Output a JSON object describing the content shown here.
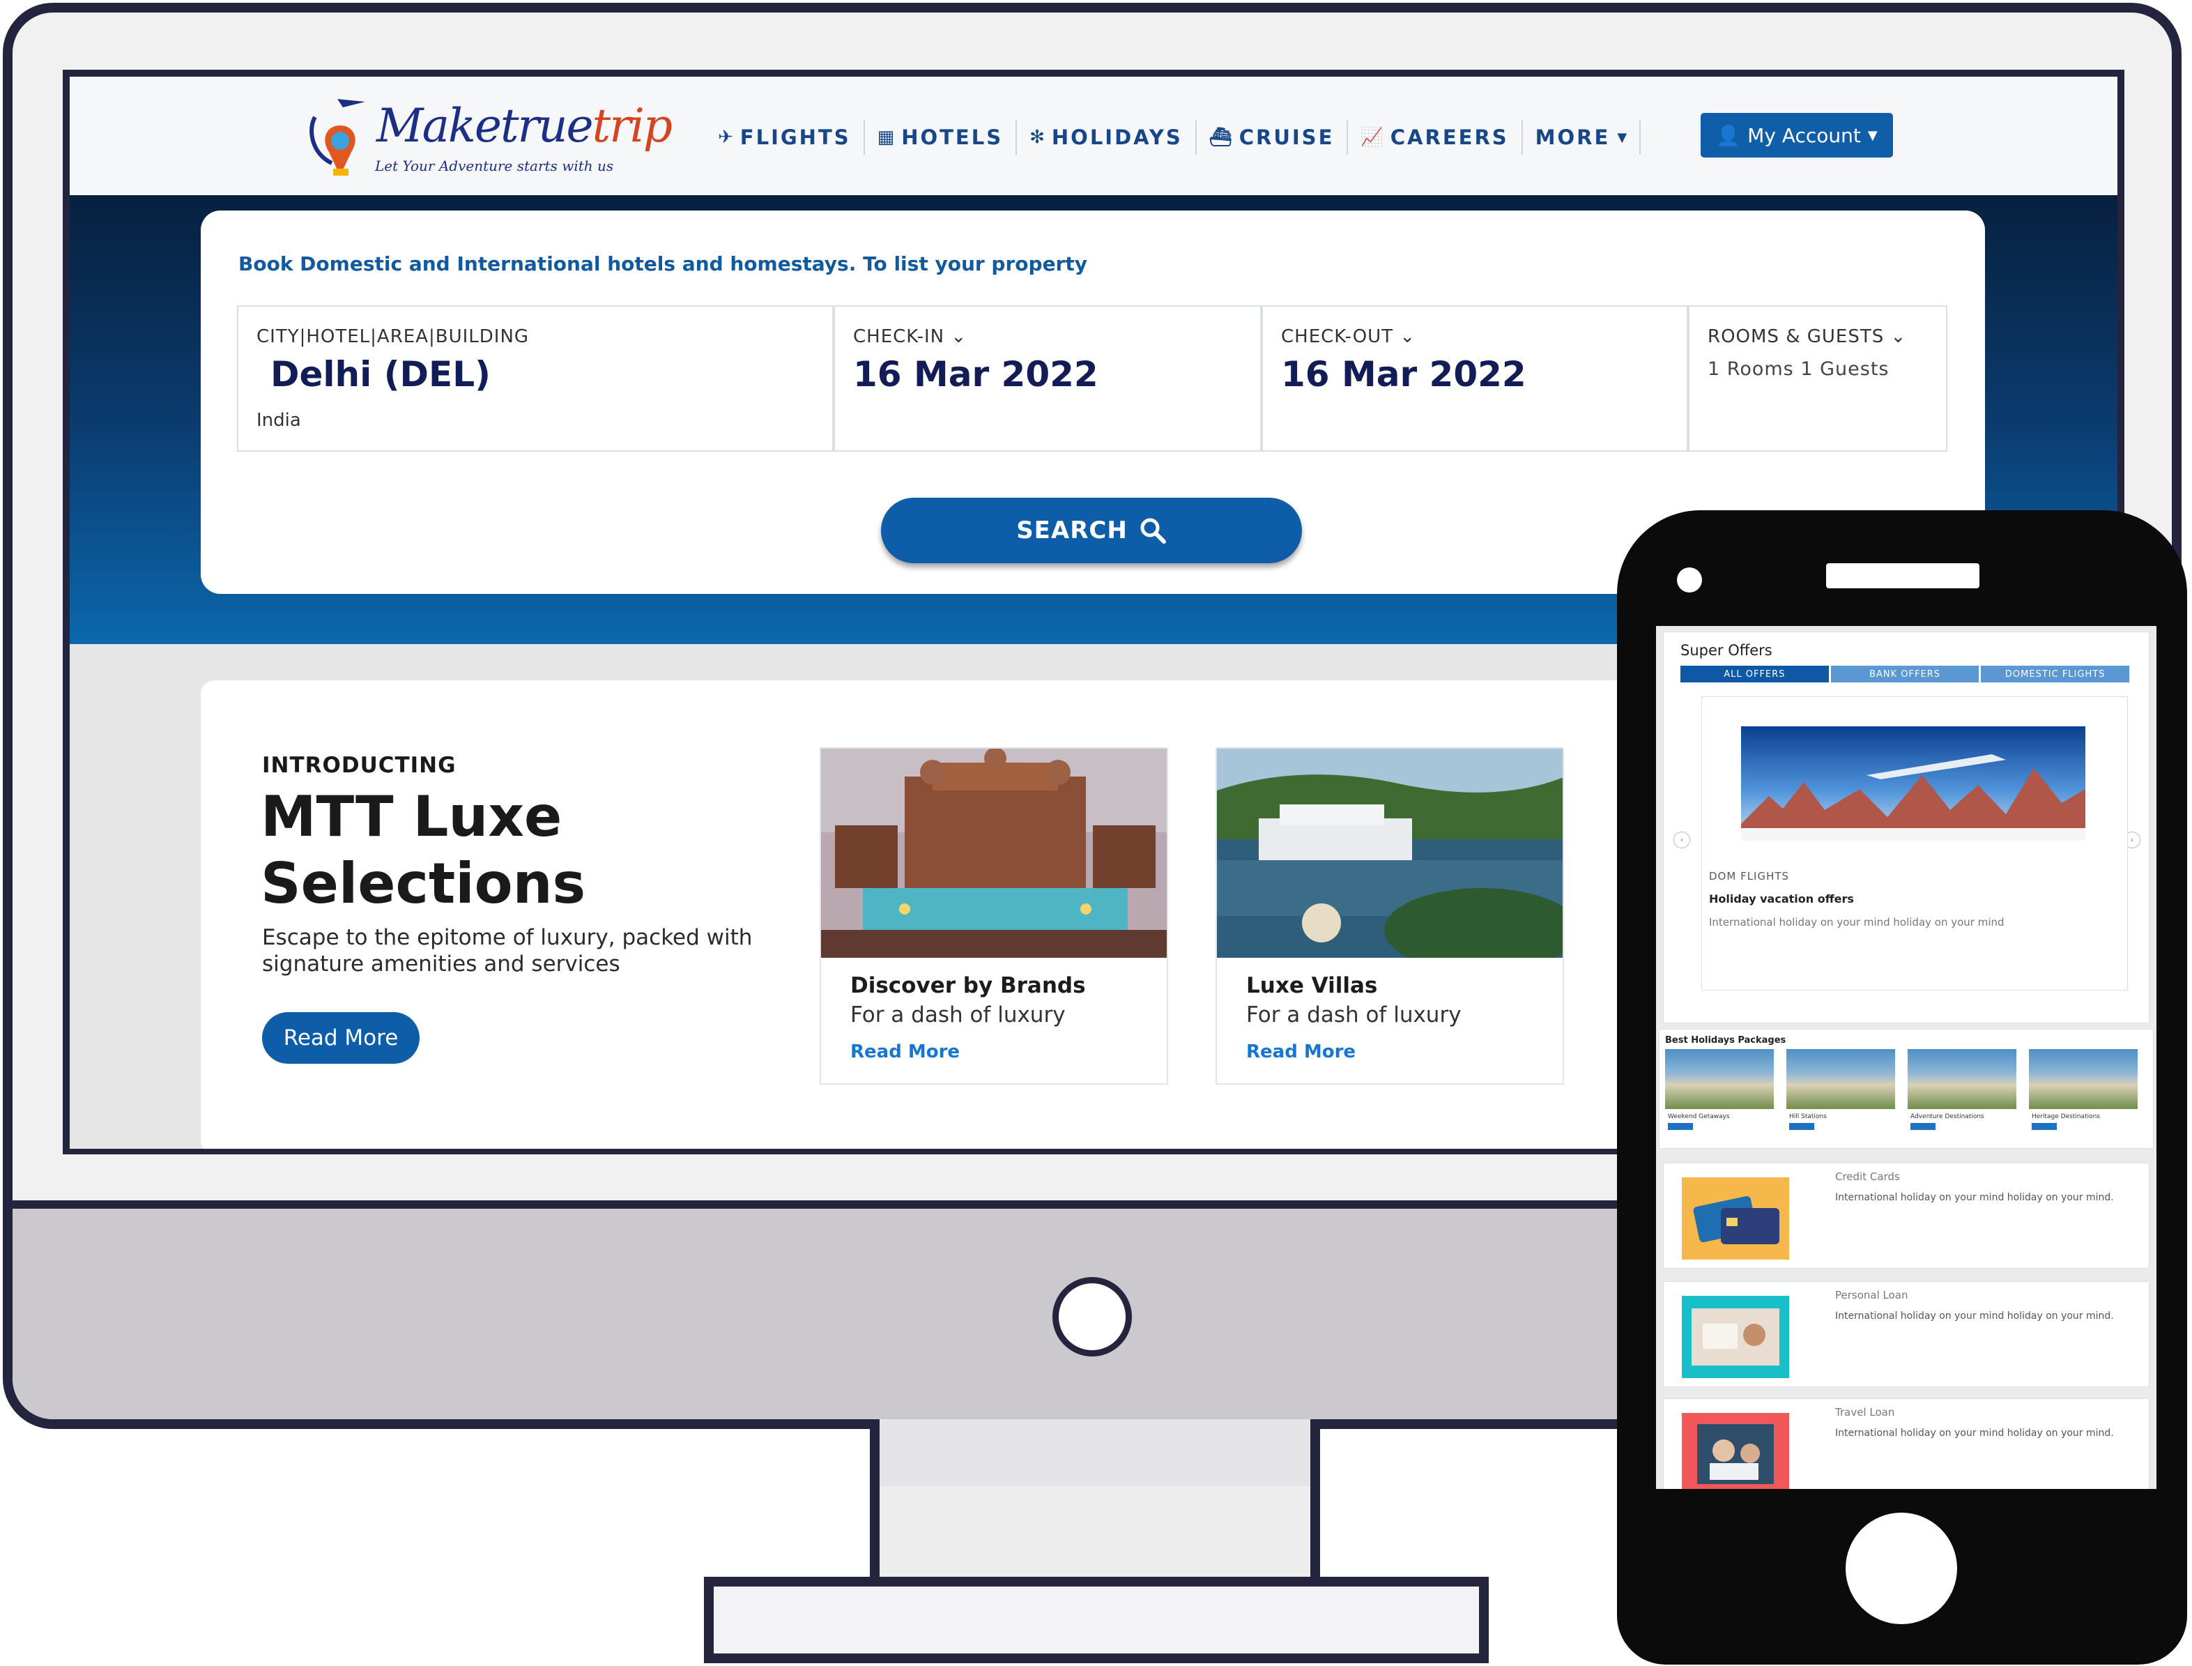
{
  "website": {
    "logo": {
      "name_main": "Maketrue",
      "name_tail": "trip",
      "tagline": "Let Your Adventure starts with us"
    },
    "nav": [
      {
        "label": "FLIGHTS",
        "icon": "plane-icon"
      },
      {
        "label": "HOTELS",
        "icon": "building-icon"
      },
      {
        "label": "HOLIDAYS",
        "icon": "palm-icon"
      },
      {
        "label": "CRUISE",
        "icon": "ship-icon"
      },
      {
        "label": "CAREERS",
        "icon": "chart-line-icon"
      },
      {
        "label": "MORE",
        "icon": "chevron-down-icon"
      }
    ],
    "account_label": "My Account",
    "search": {
      "heading": "Book Domestic and International hotels and homestays. To list your property",
      "city": {
        "label": "CITY|HOTEL|AREA|BUILDING",
        "value": "Delhi (DEL)",
        "sub": "India"
      },
      "checkin": {
        "label": "CHECK-IN",
        "value": "16 Mar 2022"
      },
      "checkout": {
        "label": "CHECK-OUT",
        "value": "16 Mar 2022"
      },
      "rooms": {
        "label": "ROOMS & GUESTS",
        "rooms_count": "1",
        "rooms_word": "Rooms",
        "guests_count": "1",
        "guests_word": "Guests"
      },
      "button_label": "SEARCH"
    },
    "promo": {
      "intro": "INTRODUCTING",
      "title": "MTT Luxe Selections",
      "description": "Escape to the epitome of luxury, packed with signature amenities and services",
      "button_label": "Read More",
      "cards": [
        {
          "title": "Discover by Brands",
          "subtitle": "For a dash of luxury",
          "link": "Read More"
        },
        {
          "title": "Luxe Villas",
          "subtitle": "For a dash of luxury",
          "link": "Read More"
        }
      ]
    }
  },
  "phone": {
    "offers": {
      "title": "Super Offers",
      "tabs": [
        "ALL OFFERS",
        "BANK OFFERS",
        "DOMESTIC FLIGHTS"
      ],
      "card": {
        "tag": "DOM FLIGHTS",
        "title": "Holiday vacation offers",
        "description": "International holiday on your mind holiday on your mind"
      }
    },
    "packages": {
      "title": "Best Holidays Packages",
      "items": [
        "Weekend Getaways",
        "Hill Stations",
        "Adventure Destinations",
        "Heritage Destinations"
      ]
    },
    "finance": [
      {
        "title": "Credit Cards",
        "description": "International holiday on your mind holiday on your mind."
      },
      {
        "title": "Personal Loan",
        "description": "International holiday on your mind holiday on your mind."
      },
      {
        "title": "Travel Loan",
        "description": "International holiday on your mind holiday on your mind."
      }
    ]
  },
  "colors": {
    "brand_blue": "#0d5da8",
    "nav_text": "#17468a",
    "frame": "#24243e"
  }
}
